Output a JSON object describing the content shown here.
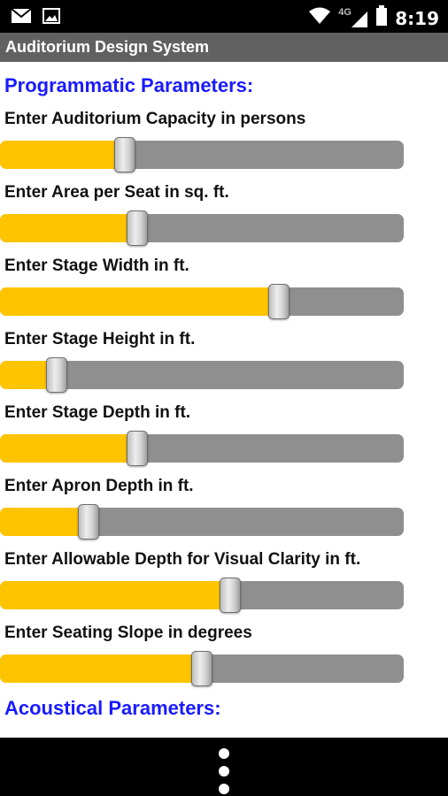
{
  "status_bar": {
    "time": "8:19",
    "network_label": "4G",
    "icons": [
      "mail-icon",
      "image-icon",
      "wifi-icon",
      "signal-icon",
      "battery-icon"
    ]
  },
  "app_bar": {
    "title": "Auditorium Design System"
  },
  "sections": {
    "programmatic": "Programmatic Parameters:",
    "acoustical": "Acoustical Parameters:"
  },
  "parameters": [
    {
      "label": "Enter Auditorium Capacity in persons",
      "level": 0.31
    },
    {
      "label": "Enter Area per Seat in sq. ft.",
      "level": 0.34
    },
    {
      "label": "Enter Stage Width in ft.",
      "level": 0.69
    },
    {
      "label": "Enter Stage Height in ft.",
      "level": 0.14
    },
    {
      "label": "Enter Stage Depth in ft.",
      "level": 0.34
    },
    {
      "label": "Enter Apron Depth in ft.",
      "level": 0.22
    },
    {
      "label": "Enter Allowable Depth for Visual Clarity in ft.",
      "level": 0.57
    },
    {
      "label": "Enter Seating Slope in degrees",
      "level": 0.5
    }
  ],
  "colors": {
    "accent_fill": "#ffc400",
    "track": "#8f8f8f",
    "section_title": "#1a1aff",
    "app_bar": "#616161"
  },
  "nav_bar": {
    "icon": "overflow-menu-icon"
  }
}
